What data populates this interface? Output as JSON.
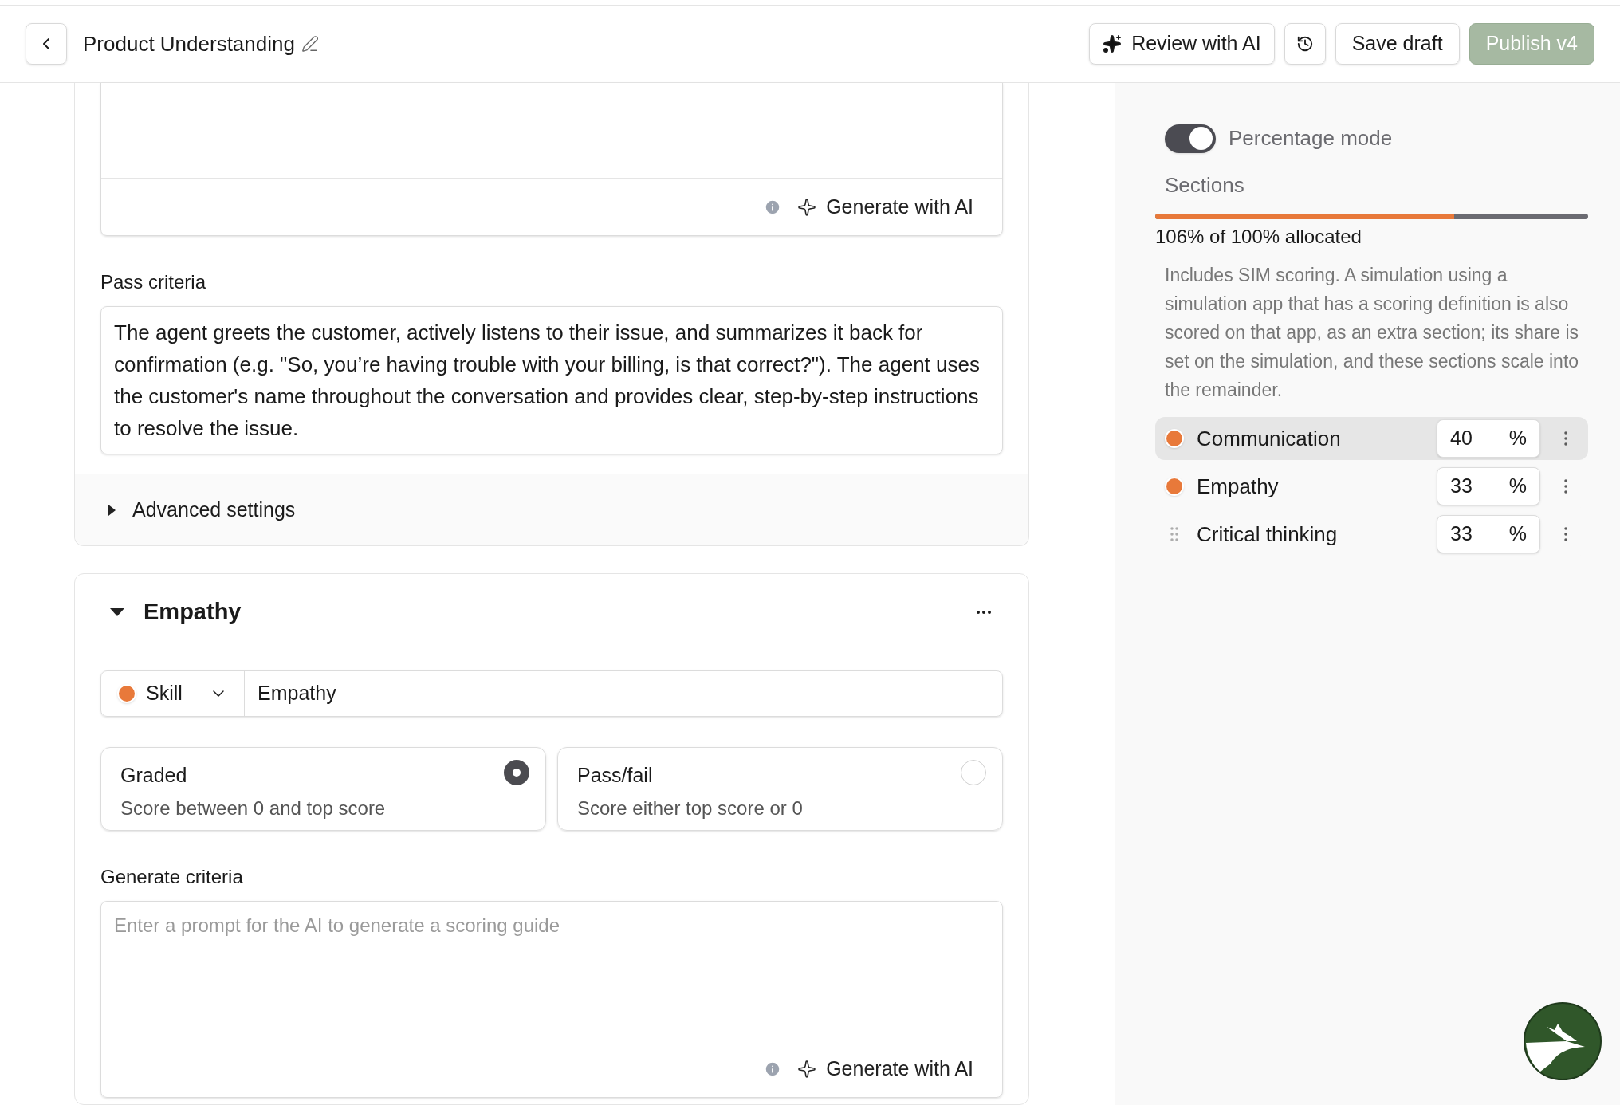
{
  "header": {
    "title": "Product Understanding",
    "review_button": "Review with AI",
    "save_button": "Save draft",
    "publish_button": {
      "label": "Publish v4",
      "disabled": true
    }
  },
  "previous_section": {
    "generate_button": "Generate with AI",
    "pass_criteria": {
      "label": "Pass criteria",
      "value": "The agent greets the customer, actively listens to their issue, and summarizes it back for confirmation (e.g. \"So, you’re having trouble with your billing, is that correct?\"). The agent uses the customer's name throughout the conversation and provides clear, step-by-step instructions to resolve the issue."
    },
    "advanced_settings": {
      "label": "Advanced settings",
      "expanded": false
    }
  },
  "section": {
    "title": "Empathy",
    "expanded": true,
    "type": {
      "label": "Skill",
      "color": "#e8793a"
    },
    "name": "Empathy",
    "scoring_options": [
      {
        "title": "Graded",
        "description": "Score between 0 and top score",
        "selected": true
      },
      {
        "title": "Pass/fail",
        "description": "Score either top score or 0",
        "selected": false
      }
    ],
    "generate_criteria": {
      "label": "Generate criteria",
      "placeholder": "Enter a prompt for the AI to generate a scoring guide",
      "button": "Generate with AI"
    }
  },
  "sidebar": {
    "percentage_mode": {
      "label": "Percentage mode",
      "on": true
    },
    "title": "Sections",
    "allocation": {
      "level": 0.69,
      "reading": "106% of 100% allocated"
    },
    "note": "Includes SIM scoring. A simulation using a simulation app that has a scoring definition is also scored on that app, as an extra section; its share is set on the simulation, and these sections scale into the remainder.",
    "sections": [
      {
        "name": "Communication",
        "value": "40",
        "unit": "%",
        "kind": "dot",
        "color": "#e8793a",
        "selected": true
      },
      {
        "name": "Empathy",
        "value": "33",
        "unit": "%",
        "kind": "dot",
        "color": "#e8793a",
        "selected": false
      },
      {
        "name": "Critical thinking",
        "value": "33",
        "unit": "%",
        "kind": "handle",
        "selected": false
      }
    ]
  }
}
